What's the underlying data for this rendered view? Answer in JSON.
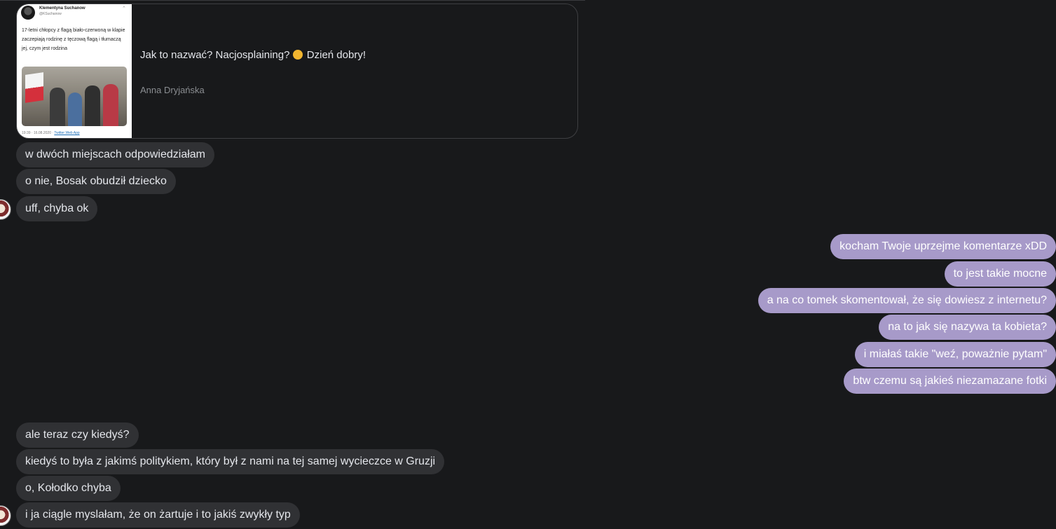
{
  "link_preview": {
    "tweet": {
      "author_name": "Klementyna Suchanow",
      "author_handle": "@KSuchanow",
      "text": "17-letni chłopcy z flagą biało-czerwoną w klapie zaczepiają rodzinę z tęczową flagą i tłumaczą jej, czym jest rodzina",
      "timestamp": "19:39 · 16.08.2020 · ",
      "app": "Twitter Web App"
    },
    "title": "Jak to nazwać? Nacjosplaining? 🤔 Dzień dobry!",
    "title_text": "Jak to nazwać? Nacjosplaining? ",
    "title_suffix": " Dzień dobry!",
    "emoji": "thinking-face",
    "author": "Anna Dryjańska"
  },
  "messages_group_1": [
    "w dwóch miejscach odpowiedziałam",
    "o nie, Bosak obudził dziecko",
    "uff, chyba ok"
  ],
  "messages_outgoing": [
    "kocham Twoje uprzejme komentarze xDD",
    "to jest takie mocne",
    "a na co tomek skomentował, że się dowiesz z internetu?",
    "na to jak się nazywa ta kobieta?",
    "i miałaś takie \"weź, poważnie pytam\"",
    "btw czemu są jakieś niezamazane fotki"
  ],
  "messages_group_2": [
    "ale teraz czy kiedyś?",
    "kiedyś to była z jakimś politykiem, który był z nami na tej samej wycieczce w Gruzji",
    "o, Kołodko chyba",
    "i ja ciągle myslałam, że on żartuje i to jakiś zwykły typ"
  ],
  "colors": {
    "background": "#18191b",
    "incoming_bubble": "#303134",
    "outgoing_bubble": "#a79ac9",
    "text": "#e4e6eb",
    "muted_text": "#8a8d91"
  }
}
